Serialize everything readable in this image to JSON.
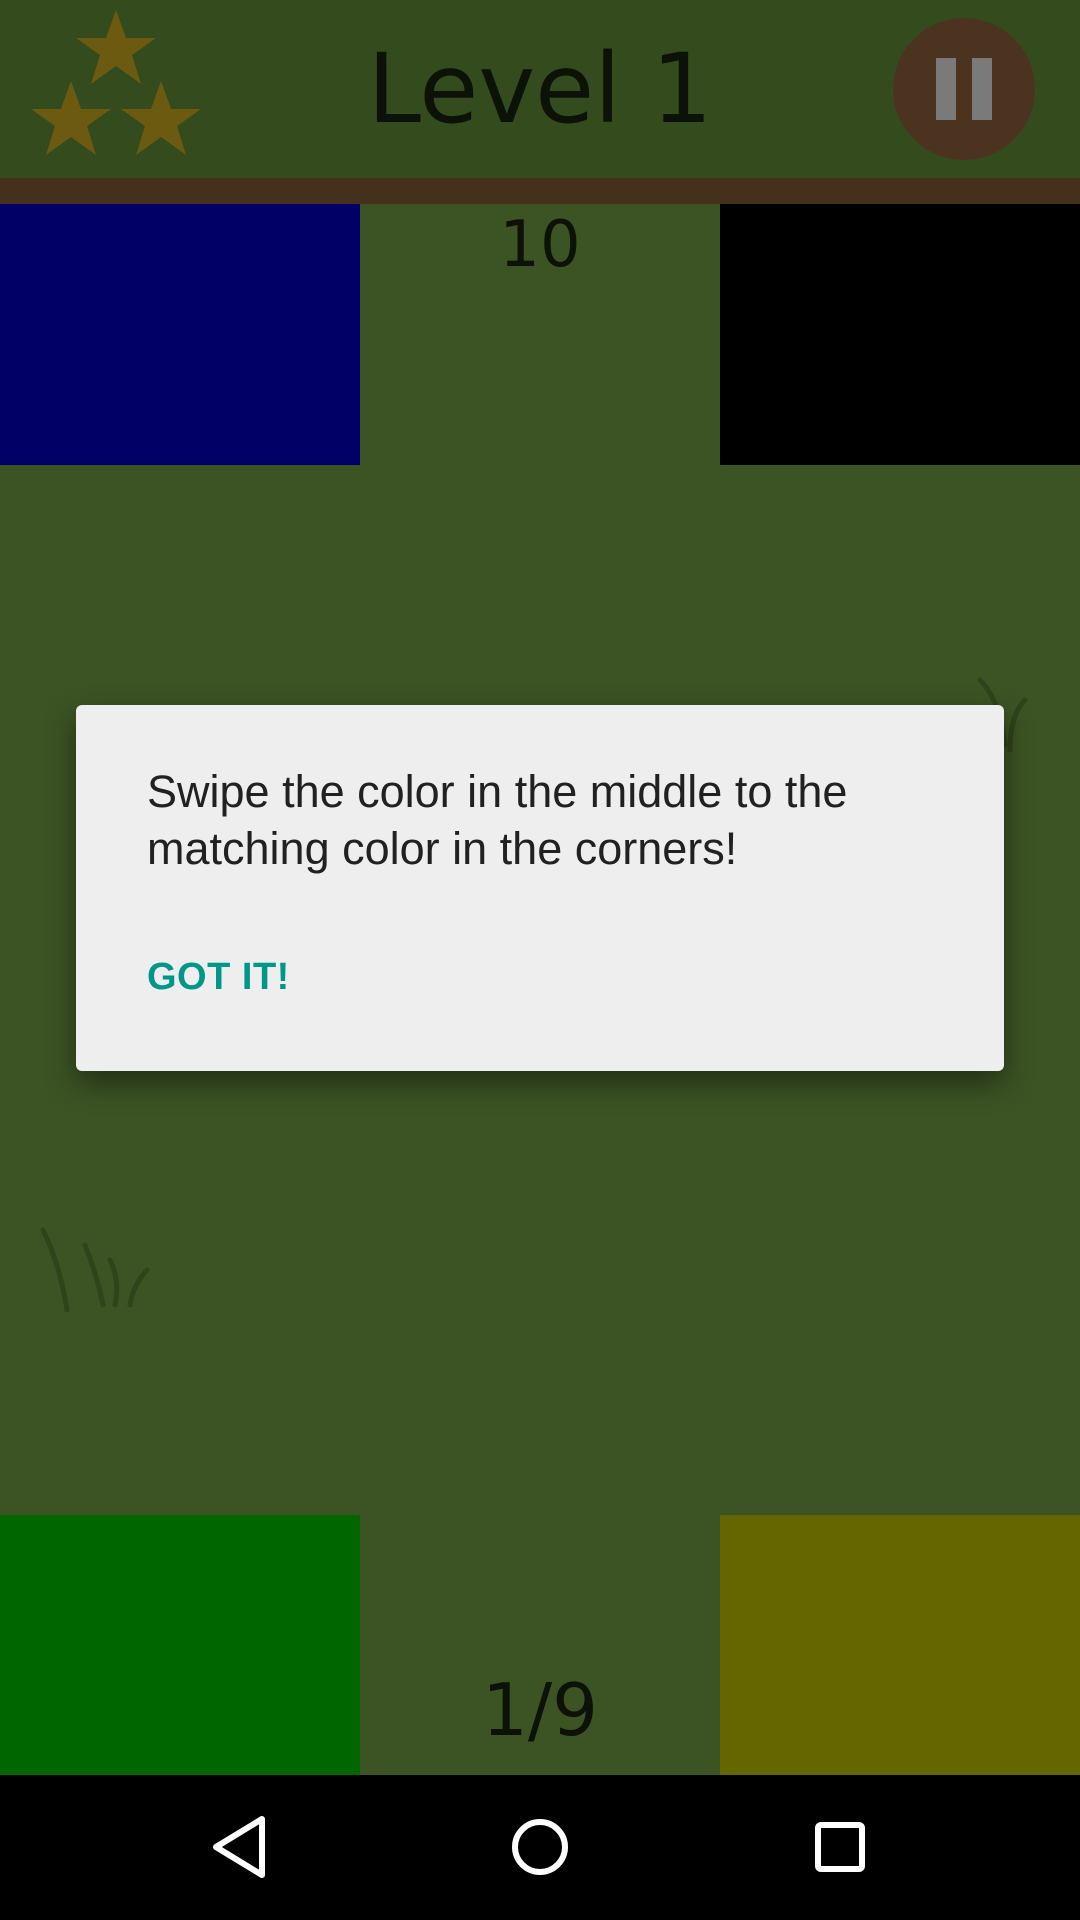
{
  "header": {
    "level_title": "Level 1",
    "stars_earned": 3,
    "stars_total": 3,
    "star_icon": "star-icon",
    "pause_icon": "pause-icon"
  },
  "game": {
    "timer": "10",
    "progress": "1/9",
    "corners": {
      "top_left_color": "#000066",
      "top_right_color": "#000000",
      "bottom_left_color": "#006600",
      "bottom_right_color": "#666600"
    }
  },
  "dialog": {
    "message": "Swipe the color in the middle to the matching color in the corners!",
    "button_label": "GOT IT!"
  },
  "nav_bar": {
    "back_icon": "back-triangle-icon",
    "home_icon": "home-circle-icon",
    "recents_icon": "recents-square-icon"
  },
  "colors": {
    "background": "#3c5424",
    "header": "#344c1d",
    "divider": "#45301c",
    "star": "#6b5a10",
    "pause_button": "#4b3320",
    "dialog_button": "#009688"
  }
}
